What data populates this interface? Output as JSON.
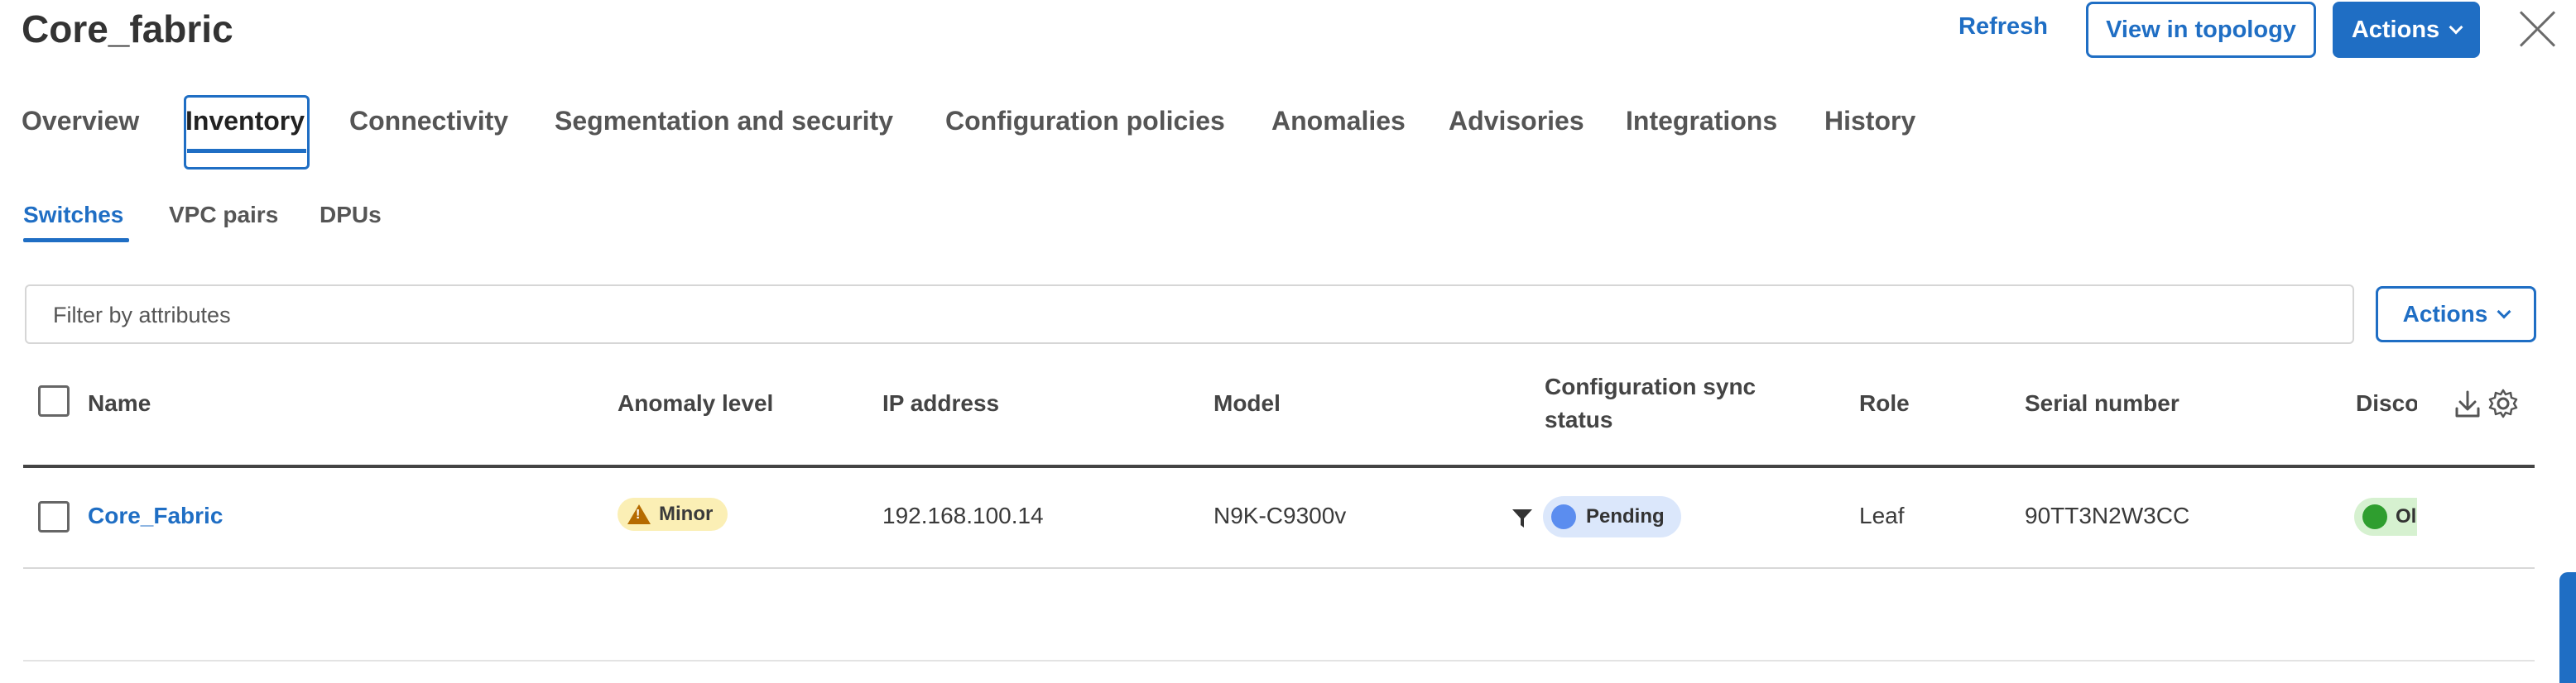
{
  "header": {
    "title": "Core_fabric",
    "refresh_label": "Refresh",
    "view_topology_label": "View in topology",
    "actions_label": "Actions"
  },
  "tabs": [
    {
      "label": "Overview"
    },
    {
      "label": "Inventory",
      "active": true
    },
    {
      "label": "Connectivity"
    },
    {
      "label": "Segmentation and security"
    },
    {
      "label": "Configuration policies"
    },
    {
      "label": "Anomalies"
    },
    {
      "label": "Advisories"
    },
    {
      "label": "Integrations"
    },
    {
      "label": "History"
    }
  ],
  "subtabs": [
    {
      "label": "Switches",
      "active": true
    },
    {
      "label": "VPC pairs"
    },
    {
      "label": "DPUs"
    }
  ],
  "filter": {
    "placeholder": "Filter by attributes",
    "actions_label": "Actions"
  },
  "table": {
    "columns": {
      "name": "Name",
      "anomaly": "Anomaly level",
      "ip": "IP address",
      "model": "Model",
      "sync_line1": "Configuration sync",
      "sync_line2": "status",
      "role": "Role",
      "serial": "Serial number",
      "disco": "Disco"
    },
    "rows": [
      {
        "name": "Core_Fabric",
        "anomaly": "Minor",
        "ip": "192.168.100.14",
        "model": "N9K-C9300v",
        "sync_status": "Pending",
        "role": "Leaf",
        "serial": "90TT3N2W3CC",
        "disco": "Ol"
      }
    ]
  },
  "colors": {
    "accent": "#1f6ec4",
    "minor_badge_bg": "#fbefb5",
    "pending_badge_bg": "#dbe7fb",
    "pending_dot": "#5b8def",
    "ok_badge_bg": "#d6f1d0",
    "ok_dot": "#2f9e2f"
  },
  "icons": [
    "close-icon",
    "chevron-down-icon",
    "warning-icon",
    "filter-icon",
    "download-icon",
    "gear-icon",
    "status-dot-icon"
  ]
}
